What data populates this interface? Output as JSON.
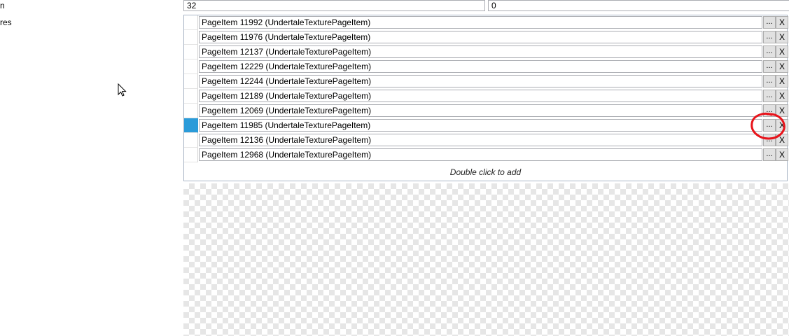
{
  "left_panel": {
    "label_1": "n",
    "label_2": "res"
  },
  "fields": {
    "value_a": "32",
    "value_b": "0"
  },
  "grid": {
    "rows": [
      {
        "value": "PageItem 11992 (UndertaleTexturePageItem)",
        "selected": false
      },
      {
        "value": "PageItem 11976 (UndertaleTexturePageItem)",
        "selected": false
      },
      {
        "value": "PageItem 12137 (UndertaleTexturePageItem)",
        "selected": false
      },
      {
        "value": "PageItem 12229 (UndertaleTexturePageItem)",
        "selected": false
      },
      {
        "value": "PageItem 12244 (UndertaleTexturePageItem)",
        "selected": false
      },
      {
        "value": "PageItem 12189 (UndertaleTexturePageItem)",
        "selected": false
      },
      {
        "value": "PageItem 12069 (UndertaleTexturePageItem)",
        "selected": false
      },
      {
        "value": "PageItem 11985 (UndertaleTexturePageItem)",
        "selected": true
      },
      {
        "value": "PageItem 12136 (UndertaleTexturePageItem)",
        "selected": false
      },
      {
        "value": "PageItem 12968 (UndertaleTexturePageItem)",
        "selected": false
      }
    ],
    "more_button_label": "...",
    "remove_button_label": "X",
    "add_hint": "Double click to add"
  },
  "colors": {
    "selection": "#2a9bd9",
    "annotation": "#e8141b"
  },
  "icons": {
    "cursor": "mouse-pointer-icon"
  }
}
